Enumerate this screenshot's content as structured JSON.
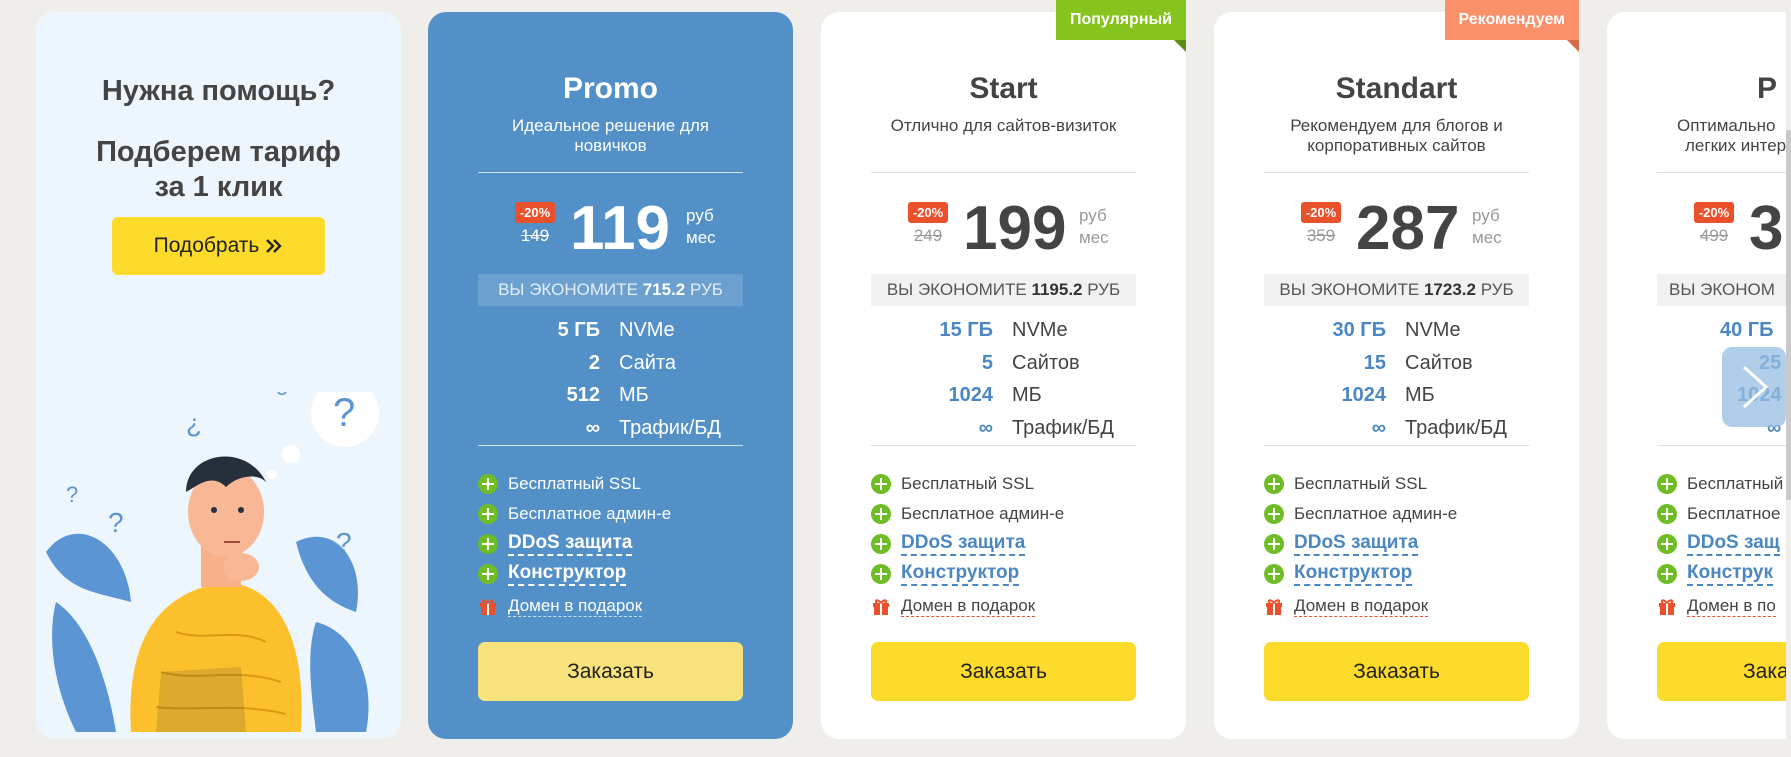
{
  "help": {
    "title": "Нужна помощь?",
    "subtitle_line1": "Подберем тариф",
    "subtitle_line2": "за 1 клик",
    "button": "Подобрать"
  },
  "plans": [
    {
      "name": "Promo",
      "ribbon": "",
      "desc_line1": "Идеальное решение для",
      "desc_line2": "новичков",
      "discount": "-20%",
      "old_price": "149",
      "price": "119",
      "unit1": "руб",
      "unit2": "мес",
      "save_label": "ВЫ ЭКОНОМИТЕ",
      "save_value": "715.2",
      "save_currency": "РУБ",
      "specs": [
        {
          "value": "5 ГБ",
          "label": "NVMe"
        },
        {
          "value": "2",
          "label": "Сайта"
        },
        {
          "value": "512",
          "label": "МБ"
        },
        {
          "value": "∞",
          "label": "Трафик/БД"
        }
      ],
      "features": [
        "Бесплатный SSL",
        "Бесплатное админ-е",
        "DDoS защита",
        "Конструктор",
        "Домен в подарок"
      ],
      "order": "Заказать"
    },
    {
      "name": "Start",
      "ribbon": "Популярный",
      "desc_line1": "Отлично для сайтов-визиток",
      "desc_line2": "",
      "discount": "-20%",
      "old_price": "249",
      "price": "199",
      "unit1": "руб",
      "unit2": "мес",
      "save_label": "ВЫ ЭКОНОМИТЕ",
      "save_value": "1195.2",
      "save_currency": "РУБ",
      "specs": [
        {
          "value": "15 ГБ",
          "label": "NVMe"
        },
        {
          "value": "5",
          "label": "Сайтов"
        },
        {
          "value": "1024",
          "label": "МБ"
        },
        {
          "value": "∞",
          "label": "Трафик/БД"
        }
      ],
      "features": [
        "Бесплатный SSL",
        "Бесплатное админ-е",
        "DDoS защита",
        "Конструктор",
        "Домен в подарок"
      ],
      "order": "Заказать"
    },
    {
      "name": "Standart",
      "ribbon": "Рекомендуем",
      "desc_line1": "Рекомендуем для блогов и",
      "desc_line2": "корпоративных сайтов",
      "discount": "-20%",
      "old_price": "359",
      "price": "287",
      "unit1": "руб",
      "unit2": "мес",
      "save_label": "ВЫ ЭКОНОМИТЕ",
      "save_value": "1723.2",
      "save_currency": "РУБ",
      "specs": [
        {
          "value": "30 ГБ",
          "label": "NVMe"
        },
        {
          "value": "15",
          "label": "Сайтов"
        },
        {
          "value": "1024",
          "label": "МБ"
        },
        {
          "value": "∞",
          "label": "Трафик/БД"
        }
      ],
      "features": [
        "Бесплатный SSL",
        "Бесплатное админ-е",
        "DDoS защита",
        "Конструктор",
        "Домен в подарок"
      ],
      "order": "Заказать"
    },
    {
      "name": "P",
      "ribbon": "",
      "desc_line1": "Оптимально",
      "desc_line2": "легких интер",
      "discount": "-20%",
      "old_price": "499",
      "price": "3",
      "unit1": "",
      "unit2": "",
      "save_label": "ВЫ ЭКОНОМ",
      "save_value": "",
      "save_currency": "",
      "specs": [
        {
          "value": "40 ГБ",
          "label": ""
        },
        {
          "value": "25",
          "label": ""
        },
        {
          "value": "1024",
          "label": ""
        },
        {
          "value": "∞",
          "label": ""
        }
      ],
      "features": [
        "Бесплатный",
        "Бесплатное",
        "DDoS защ",
        "Конструк",
        "Домен в по"
      ],
      "order": "Зака"
    }
  ],
  "colors": {
    "page_bg": "#efeeeb",
    "promo_bg": "#5390c7",
    "accent_yellow": "#fcdb2b",
    "discount_red": "#e8512c",
    "link_blue": "#4a87c3",
    "ribbon_green": "#86c31c",
    "ribbon_salmon": "#f9906a"
  },
  "icons": {
    "pick_arrow": "double-chevron-right-icon",
    "feature": "plus-circle-icon",
    "gift": "gift-icon",
    "next": "chevron-right-icon"
  }
}
